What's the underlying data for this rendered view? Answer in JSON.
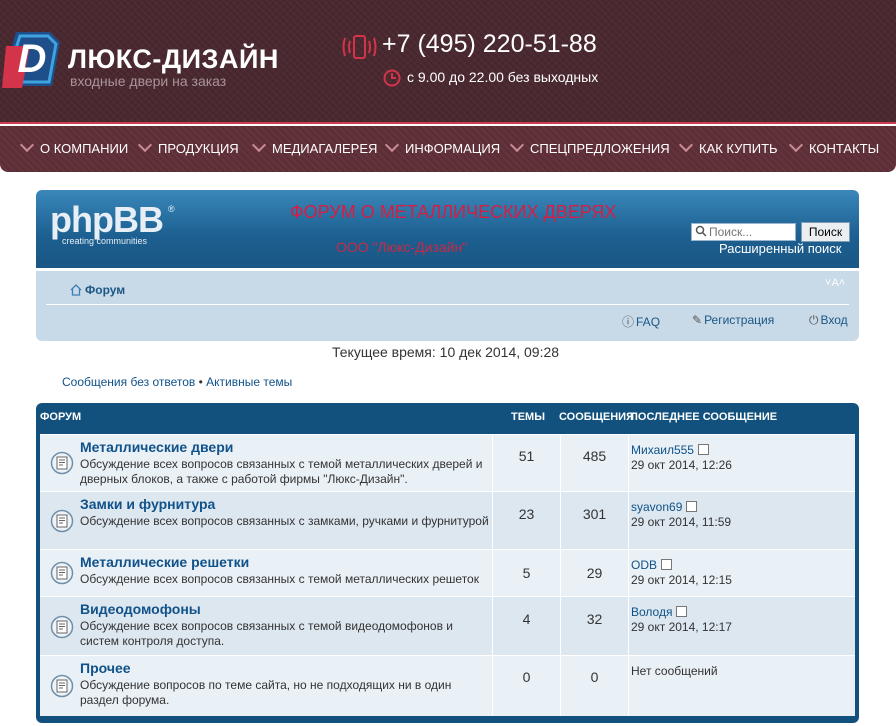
{
  "site": {
    "logo_name": "ЛЮКС-ДИЗАЙН",
    "logo_sub": "входные двери на заказ",
    "phone": "+7 (495) 220-51-88",
    "hours": "с 9.00 до 22.00 без выходных",
    "brand_color": "#cc3d50",
    "header_bg": "#4a2830"
  },
  "nav": [
    "О КОМПАНИИ",
    "ПРОДУКЦИЯ",
    "МЕДИАГАЛЕРЕЯ",
    "ИНФОРМАЦИЯ",
    "СПЕЦПРЕДЛОЖЕНИЯ",
    "КАК КУПИТЬ",
    "КОНТАКТЫ"
  ],
  "forum": {
    "logo_text": "phpBB",
    "logo_tagline": "creating communities",
    "title": "ФОРУМ О МЕТАЛЛИЧЕСКИХ ДВЕРЯХ",
    "description": "ООО \"Люкс-Дизайн\"",
    "search_placeholder": "Поиск...",
    "search_button": "Поиск",
    "advanced_search": "Расширенный поиск",
    "breadcrumb": "Форум",
    "font_size_ctrl": "A",
    "faq": "FAQ",
    "register": "Регистрация",
    "login": "Вход",
    "current_time": "Текущее время: 10 дек 2014, 09:28",
    "unanswered": "Сообщения без ответов",
    "separator": " • ",
    "active_topics": "Активные темы",
    "columns": {
      "forum": "ФОРУМ",
      "topics": "ТЕМЫ",
      "posts": "СООБЩЕНИЯ",
      "last_post": "ПОСЛЕДНЕЕ СООБЩЕНИЕ"
    },
    "rows": [
      {
        "name": "Металлические двери",
        "desc": "Обсуждение всех вопросов связанных с темой металлических дверей и дверных блоков, а также с работой фирмы \"Люкс-Дизайн\".",
        "topics": "51",
        "posts": "485",
        "last_author": "Михаил555",
        "last_date": "29 окт 2014, 12:26"
      },
      {
        "name": "Замки и фурнитура",
        "desc": "Обсуждение всех вопросов связанных с замками, ручками и фурнитурой",
        "topics": "23",
        "posts": "301",
        "last_author": "syavon69",
        "last_date": "29 окт 2014, 11:59"
      },
      {
        "name": "Металлические решетки",
        "desc": "Обсуждение всех вопросов связанных с темой металлических решеток",
        "topics": "5",
        "posts": "29",
        "last_author": "ODB",
        "last_date": "29 окт 2014, 12:15"
      },
      {
        "name": "Видеодомофоны",
        "desc": "Обсуждение всех вопросов связанных с темой видеодомофонов и систем контроля доступа.",
        "topics": "4",
        "posts": "32",
        "last_author": "Володя",
        "last_date": "29 окт 2014, 12:17"
      },
      {
        "name": "Прочее",
        "desc": "Обсуждение вопросов по теме сайта, но не подходящих ни в один раздел форума.",
        "topics": "0",
        "posts": "0",
        "no_posts": "Нет сообщений"
      }
    ]
  }
}
